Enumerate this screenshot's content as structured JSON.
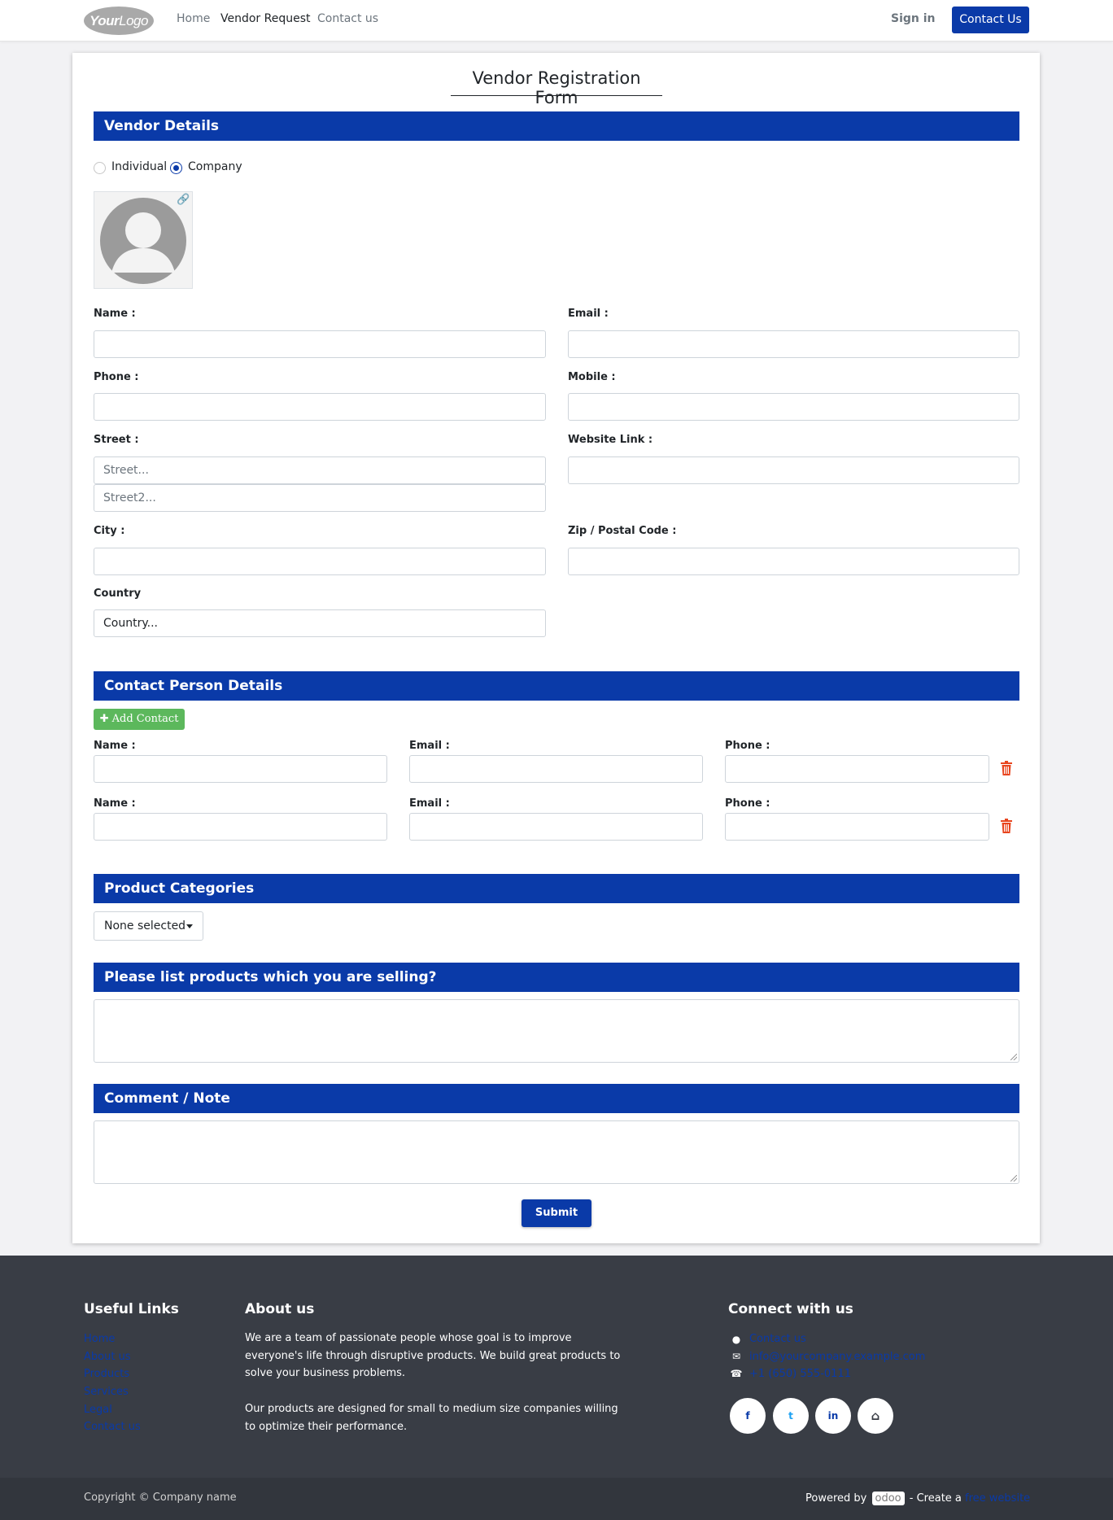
{
  "header": {
    "logo_bold": "Your",
    "logo_rest": "Logo",
    "nav": [
      "Home",
      "Vendor Request",
      "Contact us"
    ],
    "sign_in": "Sign in",
    "contact_button": "Contact Us"
  },
  "form": {
    "title": "Vendor Registration Form",
    "vendor_section": "Vendor Details",
    "radio_individual": "Individual",
    "radio_company": "Company",
    "selected_type": "Company",
    "name_label": "Name :",
    "email_label": "Email :",
    "phone_label": "Phone :",
    "mobile_label": "Mobile :",
    "street_label": "Street :",
    "street_placeholder": "Street...",
    "street2_placeholder": "Street2...",
    "website_label": "Website Link :",
    "city_label": "City :",
    "zip_label": "Zip / Postal Code :",
    "country_label": "Country",
    "country_placeholder": "Country...",
    "contact_section": "Contact Person Details",
    "add_contact": "Add Contact",
    "contact_name_label": "Name :",
    "contact_email_label": "Email :",
    "contact_phone_label": "Phone :",
    "category_section": "Product Categories",
    "category_select": "None selected",
    "products_section": "Please list products which you are selling?",
    "comment_section": "Comment / Note",
    "submit": "Submit"
  },
  "footer": {
    "useful_heading": "Useful Links",
    "useful_links": [
      "Home",
      "About us",
      "Products",
      "Services",
      "Legal",
      "Contact us"
    ],
    "about_heading": "About us",
    "about_p1_lines": [
      "We are a team of passionate people whose goal is to improve",
      "everyone's life through disruptive products. We build great products to",
      "solve your business problems."
    ],
    "about_p2_lines": [
      "Our products are designed for small to medium size companies willing",
      "to optimize their performance."
    ],
    "connect_heading": "Connect with us",
    "connect_links": [
      "Contact us",
      "info@yourcompany.example.com",
      "+1 (650) 555-0111"
    ],
    "social": [
      "f",
      "t",
      "in",
      "home"
    ],
    "copyright": "Copyright © Company name",
    "powered_by": "Powered by",
    "odoo": "odoo",
    "create_a": "- Create a",
    "free_website": "free website"
  },
  "colors": {
    "primary": "#0a3aa8",
    "success": "#5cb85c",
    "danger": "#e8451e",
    "footer_bg": "#393d45"
  }
}
